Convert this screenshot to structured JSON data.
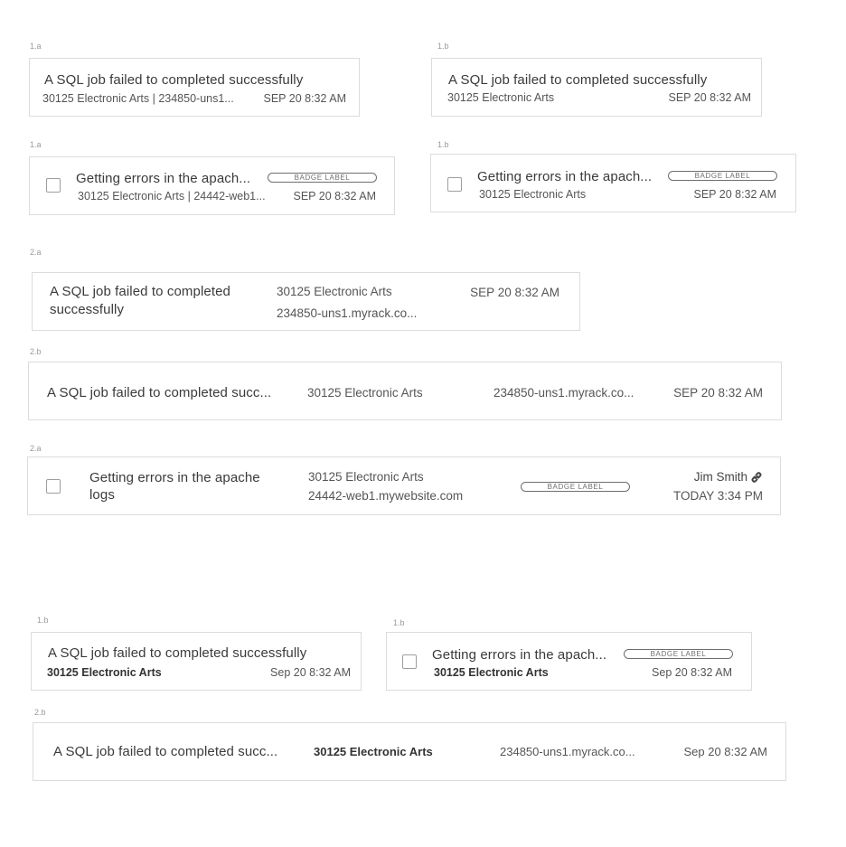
{
  "labels": {
    "l1": "1.a",
    "l2": "1.b",
    "l3": "1.a",
    "l4": "1.b",
    "l5": "2.a",
    "l6": "2.b",
    "l7": "2.a",
    "l8": "1.b",
    "l9": "1.b",
    "l10": "2.b"
  },
  "c1": {
    "title": "A SQL job failed to completed successfully",
    "sub": "30125 Electronic Arts | 234850-uns1...",
    "time": "SEP 20  8:32 AM"
  },
  "c2": {
    "title": "A SQL job failed to completed successfully",
    "sub": "30125 Electronic Arts",
    "time": "SEP 20  8:32 AM"
  },
  "c3": {
    "title": "Getting errors in the apach...",
    "badge": "BADGE LABEL",
    "sub": "30125 Electronic Arts  | 24442-web1...",
    "time": "SEP 20  8:32 AM"
  },
  "c4": {
    "title": "Getting errors in the apach...",
    "badge": "BADGE LABEL",
    "sub": "30125 Electronic Arts",
    "time": "SEP 20  8:32 AM"
  },
  "c5": {
    "title_line1": "A SQL job failed to completed",
    "title_line2": "successfully",
    "account": "30125 Electronic Arts",
    "device": "234850-uns1.myrack.co...",
    "time": "SEP 20  8:32 AM"
  },
  "c6": {
    "title": "A SQL job failed to completed succ...",
    "account": "30125 Electronic Arts",
    "device": "234850-uns1.myrack.co...",
    "time": "SEP 20  8:32 AM"
  },
  "c7": {
    "title_line1": "Getting errors in the apache",
    "title_line2": "logs",
    "account": "30125 Electronic Arts",
    "device": "24442-web1.mywebsite.com",
    "badge": "BADGE LABEL",
    "assignee": "Jim Smith",
    "time": "TODAY  3:34 PM"
  },
  "c8": {
    "title": "A SQL job failed to completed successfully",
    "sub": "30125 Electronic Arts",
    "time": "Sep 20  8:32 AM"
  },
  "c9": {
    "title": "Getting errors in the apach...",
    "badge": "BADGE LABEL",
    "sub": "30125 Electronic Arts",
    "time": "Sep 20  8:32 AM"
  },
  "c10": {
    "title": "A SQL job failed to completed succ...",
    "account": "30125 Electronic Arts",
    "device": "234850-uns1.myrack.co...",
    "time": "Sep 20 8:32 AM"
  },
  "icons": {
    "assignee_icon": "link-icon"
  }
}
